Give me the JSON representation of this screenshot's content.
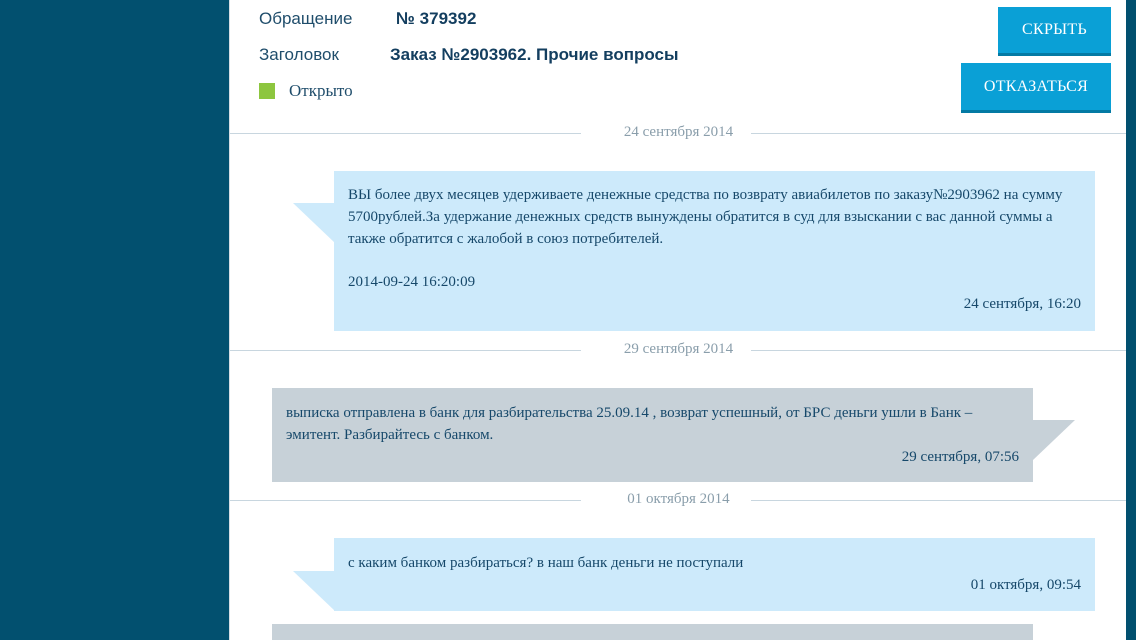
{
  "ticket": {
    "number_label": "Обращение",
    "number_value": "№ 379392",
    "title_label": "Заголовок",
    "title_value": "Заказ №2903962. Прочие вопросы",
    "status_text": "Открыто",
    "status_color": "#8dc63f"
  },
  "actions": {
    "hide_label": "СКРЫТЬ",
    "decline_label": "ОТКАЗАТЬСЯ"
  },
  "colors": {
    "sidebar": "#02506f",
    "accent": "#0aa0d6",
    "incoming_bubble": "#cdeafb",
    "outgoing_bubble": "#c7d1d8"
  },
  "thread": {
    "dates": [
      "24 сентября 2014",
      "29 сентября 2014",
      "01 октября 2014"
    ],
    "messages": [
      {
        "direction": "incoming",
        "text": "ВЫ более двух месяцев удерживаете денежные средства по возврату авиабилетов по заказу№2903962 на сумму 5700рублей.За удержание денежных средств вынуждены обратится в суд для взыскании с вас данной суммы а также обратится с жалобой в союз потребителей.",
        "extra": "2014-09-24 16:20:09",
        "time": "24 сентября, 16:20"
      },
      {
        "direction": "outgoing",
        "text": "выписка отправлена в банк для разбирательства 25.09.14 , возврат успешный, от БРС деньги ушли в Банк – эмитент. Разбирайтесь с банком.",
        "time": "29 сентября, 07:56"
      },
      {
        "direction": "incoming",
        "text": "с каким банком разбираться? в наш банк деньги не поступали",
        "time": "01 октября, 09:54"
      }
    ]
  }
}
